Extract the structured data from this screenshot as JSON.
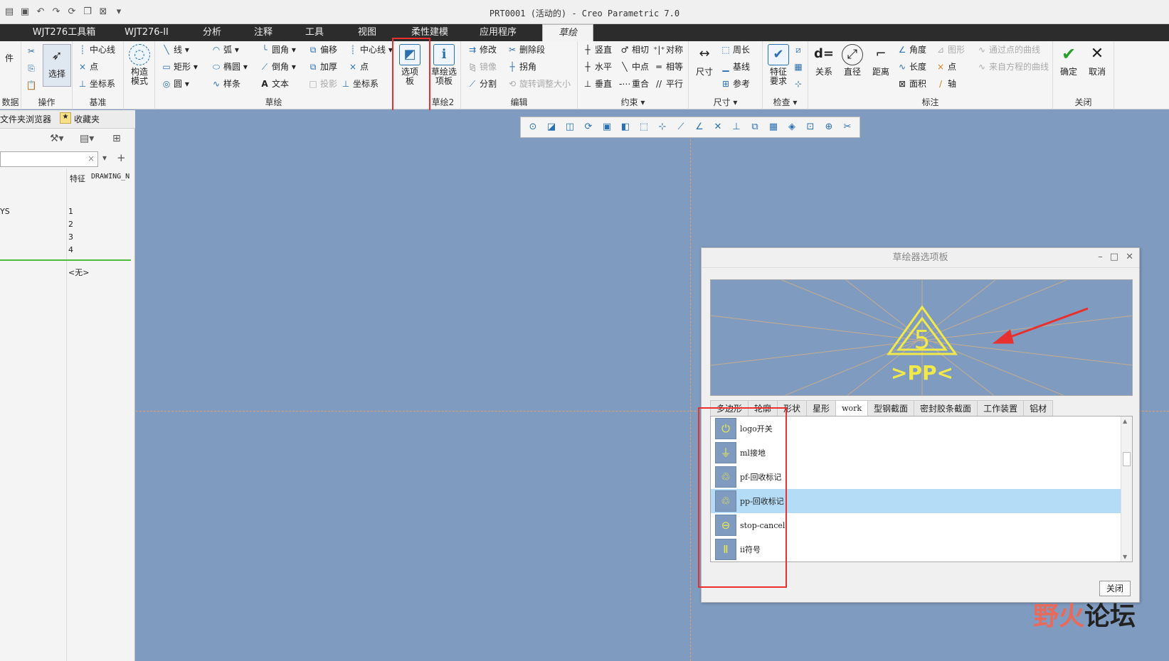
{
  "window": {
    "title": "PRT0001 (活动的) - Creo Parametric 7.0"
  },
  "menu_tabs": [
    {
      "label": "WJT276工具箱"
    },
    {
      "label": "WJT276-II"
    },
    {
      "label": "分析"
    },
    {
      "label": "注释"
    },
    {
      "label": "工具"
    },
    {
      "label": "视图"
    },
    {
      "label": "柔性建模"
    },
    {
      "label": "应用程序"
    },
    {
      "label": "草绘"
    }
  ],
  "ribbon": {
    "data_group": {
      "top": "件",
      "bottom": "数据"
    },
    "ops": {
      "select": "选择",
      "label": "操作"
    },
    "datum": {
      "centerline": "中心线",
      "point": "点",
      "coordsys": "坐标系",
      "label": "基准"
    },
    "construct": {
      "label1": "构造",
      "label2": "模式"
    },
    "sketch": {
      "line": "线",
      "arc": "弧",
      "fillet": "圆角",
      "offset": "偏移",
      "centerline": "中心线",
      "rect": "矩形",
      "ellipse": "椭圆",
      "chamfer": "倒角",
      "thicken": "加厚",
      "point": "点",
      "circle": "圆",
      "spline": "样条",
      "text": "文本",
      "project": "投影",
      "coordsys": "坐标系",
      "label": "草绘"
    },
    "palette": {
      "line1": "选项",
      "line2": "板"
    },
    "sketch2": {
      "line1": "草绘选",
      "line2": "项板",
      "label": "草绘2"
    },
    "edit": {
      "modify": "修改",
      "delete_seg": "删除段",
      "mirror": "镜像",
      "corner": "拐角",
      "divide": "分割",
      "rotate_resize": "旋转调整大小",
      "label": "编辑"
    },
    "constrain": {
      "vertical": "竖直",
      "tangent": "相切",
      "symmetric": "对称",
      "horizontal": "水平",
      "midpoint": "中点",
      "equal": "相等",
      "perpendicular": "垂直",
      "coincident": "重合",
      "parallel": "平行",
      "label": "约束"
    },
    "dimension": {
      "dim": "尺寸",
      "perimeter": "周长",
      "baseline": "基线",
      "reference": "参考",
      "label": "尺寸"
    },
    "inspect": {
      "line1": "特征",
      "line2": "要求",
      "label": "检查"
    },
    "annotate": {
      "relation": "关系",
      "diameter": "直径",
      "distance": "距离",
      "angle": "角度",
      "length": "长度",
      "area": "面积",
      "graphic": "图形",
      "point": "点",
      "axis": "轴",
      "curve_through": "通过点的曲线",
      "curve_eq": "来自方程的曲线",
      "label": "标注"
    },
    "close": {
      "ok": "确定",
      "cancel": "取消",
      "label": "关闭"
    }
  },
  "left_panel": {
    "tabs": [
      {
        "label": "文件夹浏览器"
      },
      {
        "label": "收藏夹"
      }
    ],
    "col_headers": [
      "特征",
      "DRAWING_N"
    ],
    "row_label": "YS",
    "numbers": [
      "1",
      "2",
      "3",
      "4"
    ],
    "none_text": "<无>"
  },
  "dialog": {
    "title": "草绘器选项板",
    "preview_number": "5",
    "preview_text": ">PP<",
    "tabs": [
      {
        "label": "多边形"
      },
      {
        "label": "轮廓"
      },
      {
        "label": "形状"
      },
      {
        "label": "星形"
      },
      {
        "label": "work"
      },
      {
        "label": "型钢截面"
      },
      {
        "label": "密封胶条截面"
      },
      {
        "label": "工作装置"
      },
      {
        "label": "铝材"
      }
    ],
    "items": [
      {
        "label": "logo开关",
        "icon": "⏻"
      },
      {
        "label": "ml接地",
        "icon": "⏚"
      },
      {
        "label": "pf-回收标记",
        "icon": "♲"
      },
      {
        "label": "pp-回收标记",
        "icon": "♲"
      },
      {
        "label": "stop-cancel",
        "icon": "⊖"
      },
      {
        "label": "ii符号",
        "icon": "Ⅱ"
      }
    ],
    "close_label": "关闭"
  },
  "watermark": {
    "part1": "野火",
    "part2": "论坛"
  },
  "colors": {
    "canvas": "#7f9cc0",
    "highlight": "#e8312f",
    "selected_row": "#b5dcf7",
    "accent": "#2a6fb0"
  }
}
